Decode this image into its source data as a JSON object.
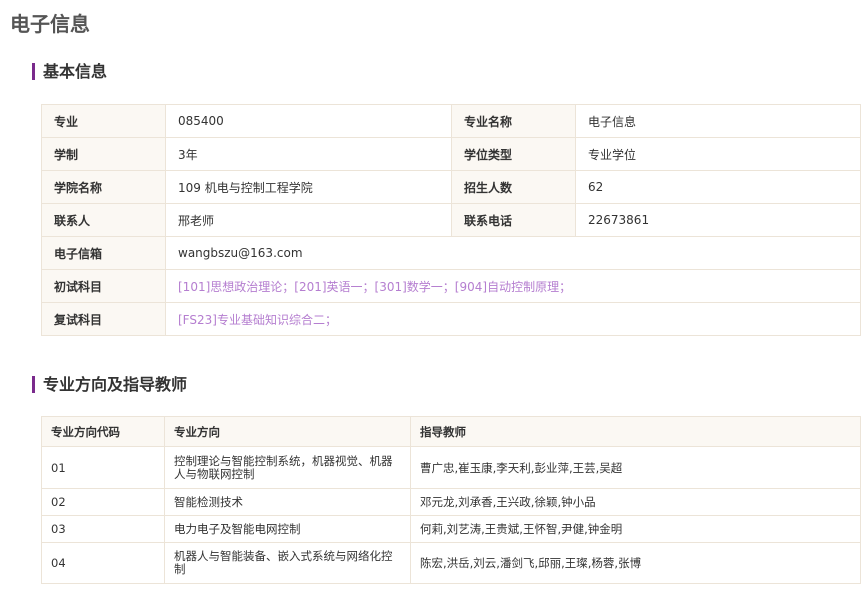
{
  "page_title": "电子信息",
  "basic_info": {
    "section_title": "基本信息",
    "rows": [
      [
        {
          "label": "专业",
          "value": "085400"
        },
        {
          "label": "专业名称",
          "value": "电子信息"
        }
      ],
      [
        {
          "label": "学制",
          "value": "3年"
        },
        {
          "label": "学位类型",
          "value": "专业学位"
        }
      ],
      [
        {
          "label": "学院名称",
          "value": "109 机电与控制工程学院"
        },
        {
          "label": "招生人数",
          "value": "62"
        }
      ],
      [
        {
          "label": "联系人",
          "value": "邢老师"
        },
        {
          "label": "联系电话",
          "value": "22673861"
        }
      ]
    ],
    "email": {
      "label": "电子信箱",
      "value": "wangbszu@163.com"
    },
    "initial_exam": {
      "label": "初试科目",
      "value": "[101]思想政治理论；[201]英语一；[301]数学一；[904]自动控制原理；"
    },
    "retest": {
      "label": "复试科目",
      "value": "[FS23]专业基础知识综合二；"
    }
  },
  "directions": {
    "section_title": "专业方向及指导教师",
    "headers": [
      "专业方向代码",
      "专业方向",
      "指导教师"
    ],
    "rows": [
      {
        "code": "01",
        "name": "控制理论与智能控制系统，机器视觉、机器人与物联网控制",
        "teachers": "曹广忠,崔玉康,李天利,彭业萍,王芸,吴超"
      },
      {
        "code": "02",
        "name": "智能检测技术",
        "teachers": "邓元龙,刘承香,王兴政,徐颖,钟小品"
      },
      {
        "code": "03",
        "name": "电力电子及智能电网控制",
        "teachers": "何莉,刘艺涛,王贵斌,王怀智,尹健,钟金明"
      },
      {
        "code": "04",
        "name": "机器人与智能装备、嵌入式系统与网络化控制",
        "teachers": "陈宏,洪岳,刘云,潘剑飞,邱丽,王璨,杨蓉,张博"
      }
    ]
  }
}
